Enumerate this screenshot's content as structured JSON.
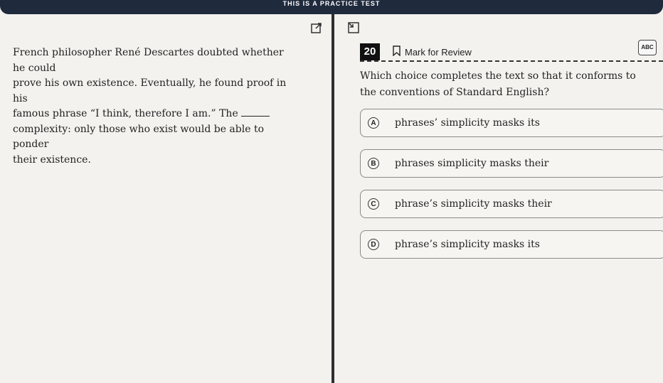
{
  "banner": "THIS IS A PRACTICE TEST",
  "passage": {
    "line1": "French philosopher René Descartes doubted whether he could",
    "line2": "prove his own existence. Eventually, he found proof in his",
    "line3": "famous phrase “I think, therefore I am.” The",
    "line4": "complexity: only those who exist would be able to ponder",
    "line5": "their existence."
  },
  "question": {
    "number": "20",
    "mark_label": "Mark for Review",
    "abc_label": "ABC",
    "prompt": "Which choice completes the text so that it conforms to the conventions of Standard English?"
  },
  "choices": [
    {
      "letter": "A",
      "text": "phrases’ simplicity masks its"
    },
    {
      "letter": "B",
      "text": "phrases simplicity masks their"
    },
    {
      "letter": "C",
      "text": "phrase’s simplicity masks their"
    },
    {
      "letter": "D",
      "text": "phrase’s simplicity masks its"
    }
  ]
}
